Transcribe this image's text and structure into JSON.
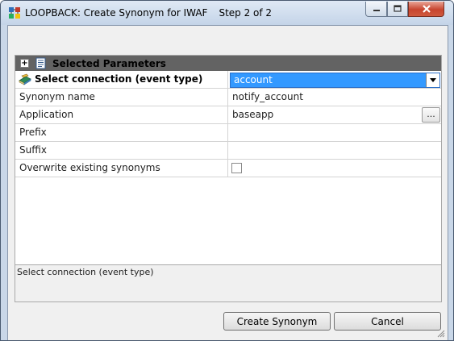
{
  "window": {
    "title": "LOOPBACK: Create Synonym for IWAF",
    "step": "Step 2 of 2"
  },
  "category": {
    "label": "Selected Parameters",
    "expander": "+"
  },
  "properties": [
    {
      "name": "Select connection (event type)",
      "value": "account"
    },
    {
      "name": "Synonym name",
      "value": "notify_account"
    },
    {
      "name": "Application",
      "value": "baseapp",
      "button_label": "..."
    },
    {
      "name": "Prefix",
      "value": ""
    },
    {
      "name": "Suffix",
      "value": ""
    },
    {
      "name": "Overwrite existing synonyms",
      "checked": false
    }
  ],
  "description": "Select connection (event type)",
  "buttons": {
    "create": "Create Synonym",
    "cancel": "Cancel"
  },
  "colors": {
    "selection": "#3399ff",
    "category_bar": "#636363"
  }
}
